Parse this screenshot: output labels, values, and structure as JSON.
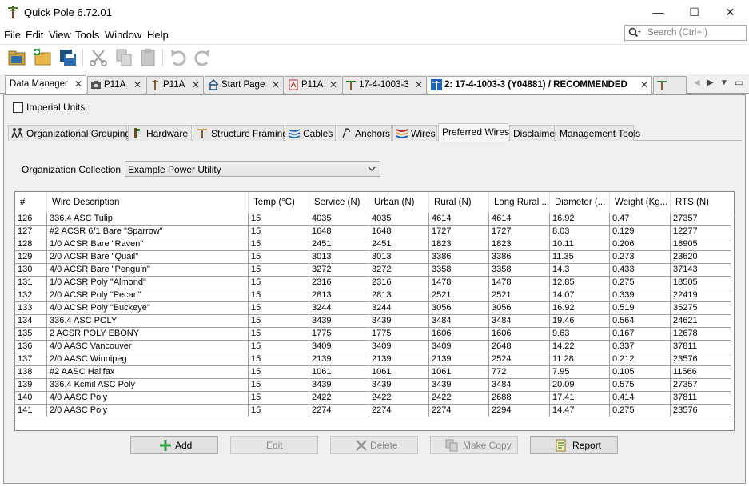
{
  "window": {
    "title": "Quick Pole 6.72.01",
    "minimize": "—",
    "maximize": "☐",
    "close": "✕"
  },
  "menu": {
    "file": "File",
    "edit": "Edit",
    "view": "View",
    "tools": "Tools",
    "window": "Window",
    "help": "Help"
  },
  "search": {
    "placeholder": "Search (Ctrl+I)"
  },
  "toolbar_icons": [
    "open-folder-icon",
    "new-project-icon",
    "save-all-icon",
    "cut-icon",
    "copy-icon",
    "paste-icon",
    "undo-icon",
    "redo-icon"
  ],
  "doc_tabs": [
    {
      "label": "Data Manager",
      "icon": "none"
    },
    {
      "label": "P11A",
      "icon": "camera-icon"
    },
    {
      "label": "P11A",
      "icon": "pole-icon"
    },
    {
      "label": "Start Page",
      "icon": "home-icon"
    },
    {
      "label": "P11A",
      "icon": "pdf-icon"
    },
    {
      "label": "17-4-1003-3",
      "icon": "structure-icon"
    },
    {
      "label": "2: 17-4-1003-3 (Y04881) / RECOMMENDED",
      "icon": "structure-icon"
    }
  ],
  "imperial_units": {
    "label": "Imperial Units",
    "checked": false
  },
  "sub_tabs": [
    {
      "label": "Organizational Groupings"
    },
    {
      "label": "Hardware"
    },
    {
      "label": "Structure Framing"
    },
    {
      "label": "Cables"
    },
    {
      "label": "Anchors"
    },
    {
      "label": "Wires"
    },
    {
      "label": "Preferred Wires"
    },
    {
      "label": "Disclaimer"
    },
    {
      "label": "Management Tools"
    }
  ],
  "org": {
    "label": "Organization Collection",
    "value": "Example Power Utility"
  },
  "table": {
    "headers": [
      "#",
      "Wire Description",
      "Temp (°C)",
      "Service (N)",
      "Urban (N)",
      "Rural (N)",
      "Long Rural ...",
      "Diameter (...",
      "Weight (Kg...",
      "RTS (N)"
    ],
    "rows": [
      [
        "126",
        "336.4 ASC Tulip",
        "15",
        "4035",
        "4035",
        "4614",
        "4614",
        "16.92",
        "0.47",
        "27357"
      ],
      [
        "127",
        "#2 ACSR 6/1 Bare \"Sparrow\"",
        "15",
        "1648",
        "1648",
        "1727",
        "1727",
        "8.03",
        "0.129",
        "12277"
      ],
      [
        "128",
        "1/0 ACSR Bare \"Raven\"",
        "15",
        "2451",
        "2451",
        "1823",
        "1823",
        "10.11",
        "0.206",
        "18905"
      ],
      [
        "129",
        "2/0 ACSR Bare \"Quail\"",
        "15",
        "3013",
        "3013",
        "3386",
        "3386",
        "11.35",
        "0.273",
        "23620"
      ],
      [
        "130",
        "4/0 ACSR Bare \"Penguin\"",
        "15",
        "3272",
        "3272",
        "3358",
        "3358",
        "14.3",
        "0.433",
        "37143"
      ],
      [
        "131",
        "1/0 ACSR Poly \"Almond\"",
        "15",
        "2316",
        "2316",
        "1478",
        "1478",
        "12.85",
        "0.275",
        "18505"
      ],
      [
        "132",
        "2/0 ACSR Poly \"Pecan\"",
        "15",
        "2813",
        "2813",
        "2521",
        "2521",
        "14.07",
        "0.339",
        "22419"
      ],
      [
        "133",
        "4/0 ACSR Poly \"Buckeye\"",
        "15",
        "3244",
        "3244",
        "3056",
        "3056",
        "16.92",
        "0.519",
        "35275"
      ],
      [
        "134",
        "336.4 ASC POLY",
        "15",
        "3439",
        "3439",
        "3484",
        "3484",
        "19.46",
        "0.564",
        "24621"
      ],
      [
        "135",
        "2 ACSR POLY EBONY",
        "15",
        "1775",
        "1775",
        "1606",
        "1606",
        "9.63",
        "0.167",
        "12678"
      ],
      [
        "136",
        "4/0 AASC Vancouver",
        "15",
        "3409",
        "3409",
        "3409",
        "2648",
        "14.22",
        "0.337",
        "37811"
      ],
      [
        "137",
        "2/0 AASC Winnipeg",
        "15",
        "2139",
        "2139",
        "2139",
        "2524",
        "11.28",
        "0.212",
        "23576"
      ],
      [
        "138",
        "#2 AASC Halifax",
        "15",
        "1061",
        "1061",
        "1061",
        "772",
        "7.95",
        "0.105",
        "11566"
      ],
      [
        "139",
        "336.4 Kcmil ASC Poly",
        "15",
        "3439",
        "3439",
        "3439",
        "3484",
        "20.09",
        "0.575",
        "27357"
      ],
      [
        "140",
        "4/0 AASC Poly",
        "15",
        "2422",
        "2422",
        "2422",
        "2688",
        "17.41",
        "0.414",
        "37811"
      ],
      [
        "141",
        "2/0 AASC Poly",
        "15",
        "2274",
        "2274",
        "2274",
        "2294",
        "14.47",
        "0.275",
        "23576"
      ]
    ]
  },
  "buttons": {
    "add": "Add",
    "edit": "Edit",
    "delete": "Delete",
    "make_copy": "Make Copy",
    "report": "Report"
  },
  "colors": {
    "accent_green": "#2ea043",
    "tab_blue": "#1565c0",
    "grid_line": "#a0a0a0"
  }
}
